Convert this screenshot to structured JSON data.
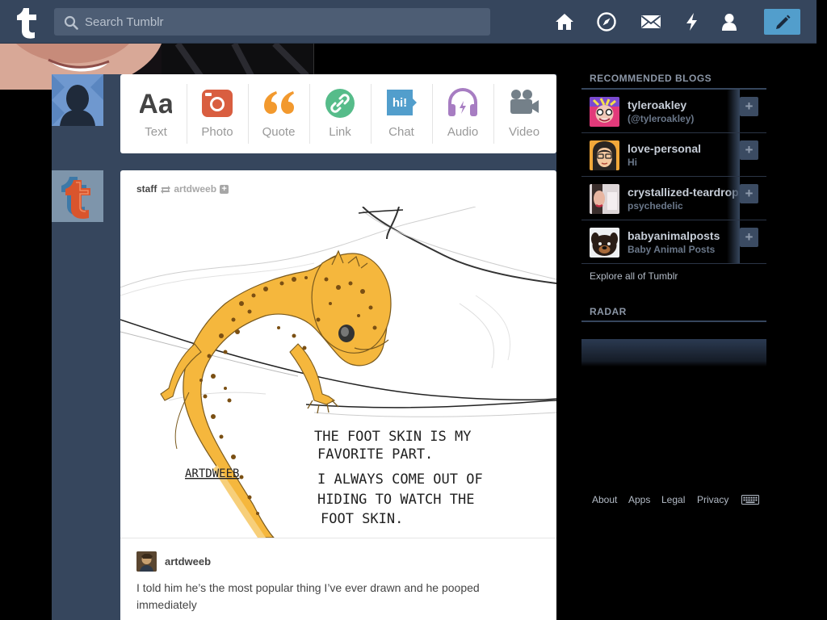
{
  "search": {
    "placeholder": "Search Tumblr"
  },
  "nav": {
    "icons": [
      "home-icon",
      "explore-icon",
      "inbox-icon",
      "activity-icon",
      "account-icon",
      "compose-icon"
    ]
  },
  "post_types": [
    {
      "label": "Text",
      "icon": "text-icon",
      "color": "#444444"
    },
    {
      "label": "Photo",
      "icon": "camera-icon",
      "color": "#d95e40"
    },
    {
      "label": "Quote",
      "icon": "quote-icon",
      "color": "#f2992e"
    },
    {
      "label": "Link",
      "icon": "link-icon",
      "color": "#56bc8a"
    },
    {
      "label": "Chat",
      "icon": "chat-icon",
      "color": "#529ecc"
    },
    {
      "label": "Audio",
      "icon": "headphones-icon",
      "color": "#a77dc2"
    },
    {
      "label": "Video",
      "icon": "video-camera-icon",
      "color": "#748089"
    }
  ],
  "post": {
    "author": "staff",
    "reblogged_from": "artdweeb",
    "image_handwriting": {
      "signature": "ARTDWEEB",
      "line1": "THE FOOT SKIN IS MY",
      "line2": "FAVORITE PART.",
      "line3": "I ALWAYS COME OUT OF",
      "line4": "HIDING TO WATCH THE",
      "line5": "FOOT SKIN."
    },
    "caption_user": "artdweeb",
    "caption_text": "I told him he’s the most popular thing I’ve ever drawn and he pooped immediately"
  },
  "sidebar": {
    "recommended_heading": "RECOMMENDED BLOGS",
    "blogs": [
      {
        "name": "tyleroakley",
        "subtitle": "(@tyleroakley)"
      },
      {
        "name": "love-personal",
        "subtitle": "Hi"
      },
      {
        "name": "crystallized-teardrops",
        "subtitle": "psychedelic"
      },
      {
        "name": "babyanimalposts",
        "subtitle": "Baby Animal Posts"
      }
    ],
    "follow_label": "+",
    "explore_link": "Explore all of Tumblr",
    "radar_heading": "RADAR"
  },
  "footer": {
    "links": [
      "About",
      "Apps",
      "Legal",
      "Privacy"
    ]
  },
  "colors": {
    "brand": "#36465d",
    "accent": "#529ecc",
    "background": "#000000"
  }
}
